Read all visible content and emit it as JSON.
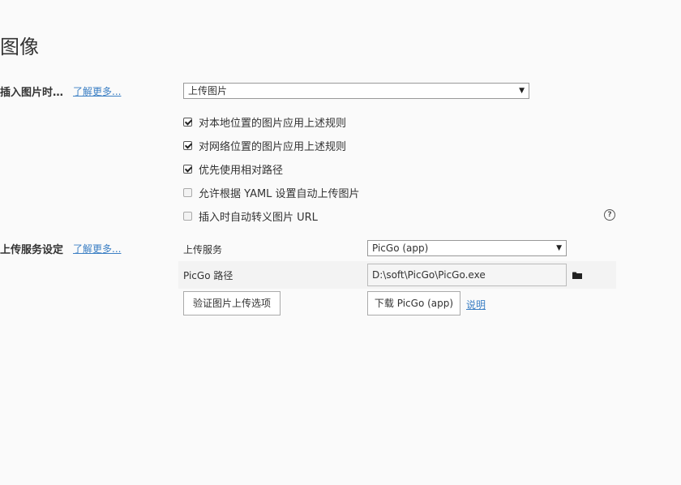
{
  "page": {
    "title": "图像"
  },
  "insert_image": {
    "label": "插入图片时…",
    "learn_more": "了解更多...",
    "action_select": "上传图片",
    "options": [
      {
        "label": "对本地位置的图片应用上述规则",
        "checked": true
      },
      {
        "label": "对网络位置的图片应用上述规则",
        "checked": true
      },
      {
        "label": "优先使用相对路径",
        "checked": true
      },
      {
        "label": "允许根据 YAML 设置自动上传图片",
        "checked": false
      },
      {
        "label": "插入时自动转义图片 URL",
        "checked": false
      }
    ],
    "help_icon": "?"
  },
  "upload_service": {
    "label": "上传服务设定",
    "learn_more": "了解更多...",
    "service_label": "上传服务",
    "service_select": "PicGo (app)",
    "path_label": "PicGo 路径",
    "path_value": "D:\\soft\\PicGo\\PicGo.exe",
    "verify_button": "验证图片上传选项",
    "download_button": "下载 PicGo (app)",
    "explain_link": "说明"
  },
  "icons": {
    "dropdown": "chevron-down-icon",
    "folder": "folder-icon",
    "help": "question-circle-icon"
  }
}
